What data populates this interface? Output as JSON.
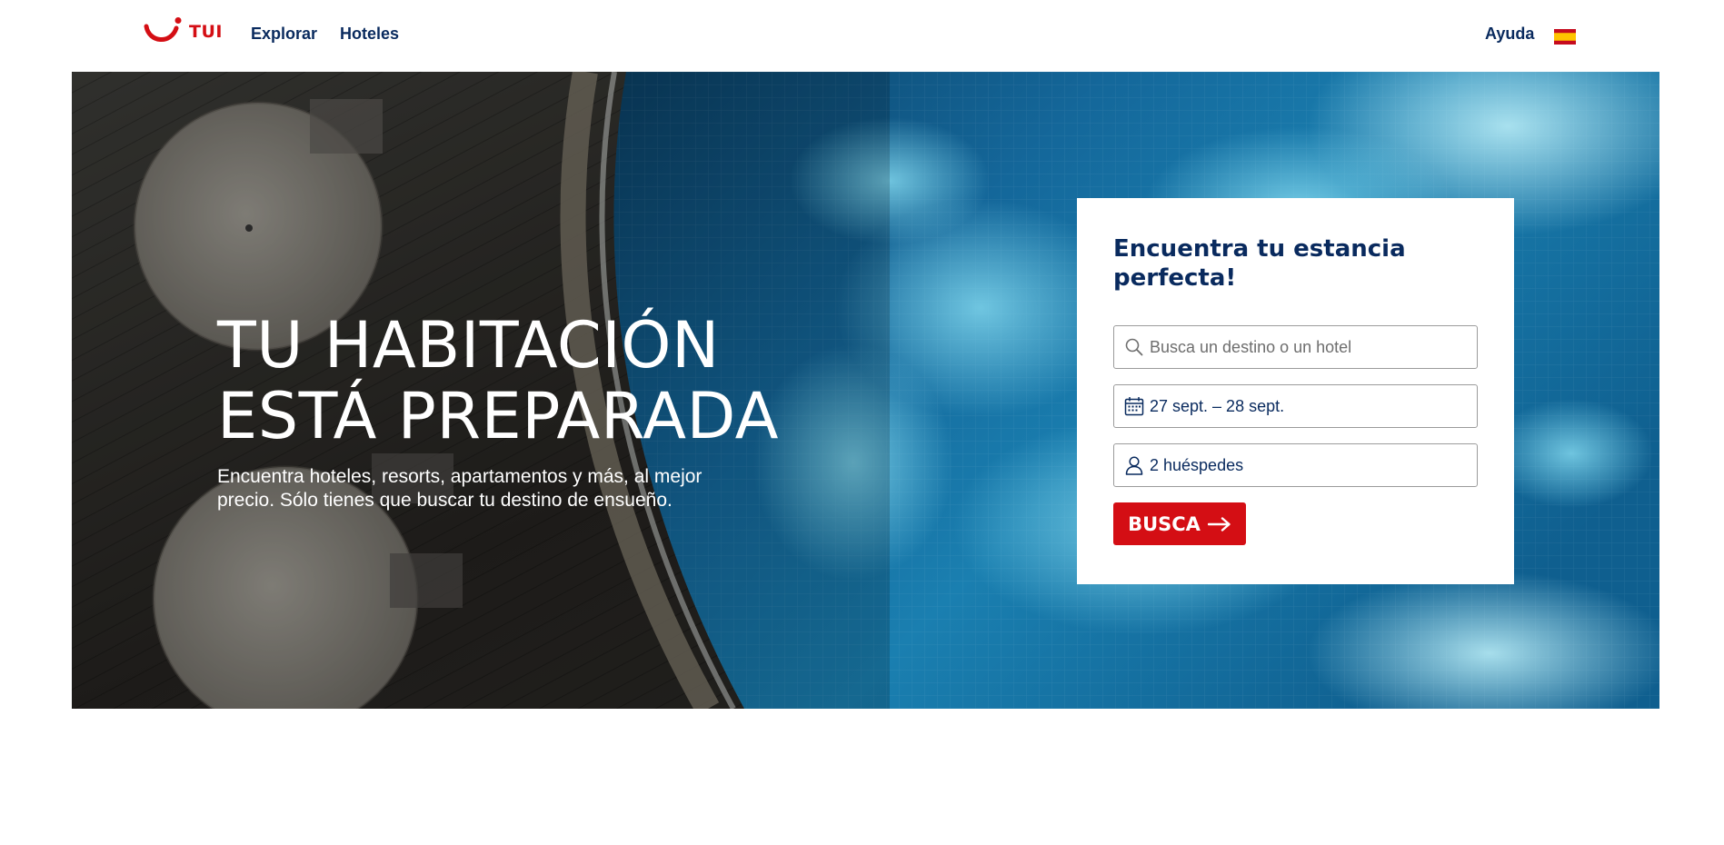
{
  "header": {
    "logo_text": "TUI",
    "nav": [
      {
        "label": "Explorar"
      },
      {
        "label": "Hoteles"
      }
    ],
    "help_label": "Ayuda",
    "language_flag": "spain-flag-icon"
  },
  "hero": {
    "title_line1": "TU HABITACIÓN",
    "title_line2": "ESTÁ PREPARADA",
    "subtitle": "Encuentra hoteles, resorts, apartamentos y más, al mejor precio. Sólo tienes que buscar tu destino de ensueño."
  },
  "search": {
    "title": "Encuentra tu estancia perfecta!",
    "destination_placeholder": "Busca un destino o un hotel",
    "destination_value": "",
    "dates_value": "27 sept. – 28 sept.",
    "guests_value": "2 huéspedes",
    "button_label": "BUSCA"
  },
  "colors": {
    "brand_red": "#d40e14",
    "brand_navy": "#092a5e"
  },
  "icons": {
    "search": "search-icon",
    "calendar": "calendar-icon",
    "guests": "user-icon",
    "button_arrow": "arrow-right-icon"
  }
}
